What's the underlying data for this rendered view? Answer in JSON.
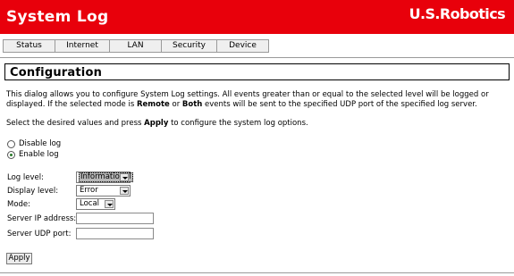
{
  "header": {
    "title": "System Log",
    "logo": "U.S.Robotics"
  },
  "nav": {
    "tabs": [
      {
        "label": "Status"
      },
      {
        "label": "Internet"
      },
      {
        "label": "LAN"
      },
      {
        "label": "Security"
      },
      {
        "label": "Device"
      }
    ]
  },
  "section": {
    "title": "Configuration"
  },
  "description": {
    "part1": "This dialog allows you to configure System Log settings. All events greater than or equal to the selected level will be logged or displayed. If the selected mode is ",
    "remote": "Remote",
    "part2": " or ",
    "both": "Both",
    "part3": " events will be sent to the specified UDP port of the specified log server."
  },
  "instruction": {
    "part1": "Select the desired values and press ",
    "apply": "Apply",
    "part2": " to configure the system log options."
  },
  "log_mode": {
    "disable_label": "Disable log",
    "enable_label": "Enable log",
    "selected": "Enable log"
  },
  "form": {
    "log_level": {
      "label": "Log level:",
      "value": "Informational"
    },
    "display_level": {
      "label": "Display level:",
      "value": "Error"
    },
    "mode": {
      "label": "Mode:",
      "value": "Local"
    },
    "server_ip": {
      "label": "Server IP address:",
      "value": ""
    },
    "server_port": {
      "label": "Server UDP port:",
      "value": ""
    }
  },
  "buttons": {
    "apply_label": "Apply"
  },
  "icons": {
    "radio_checked_color": "#2a7a2a",
    "header_color": "#e8000b",
    "dropdown_icon": "chevron-down-icon"
  }
}
